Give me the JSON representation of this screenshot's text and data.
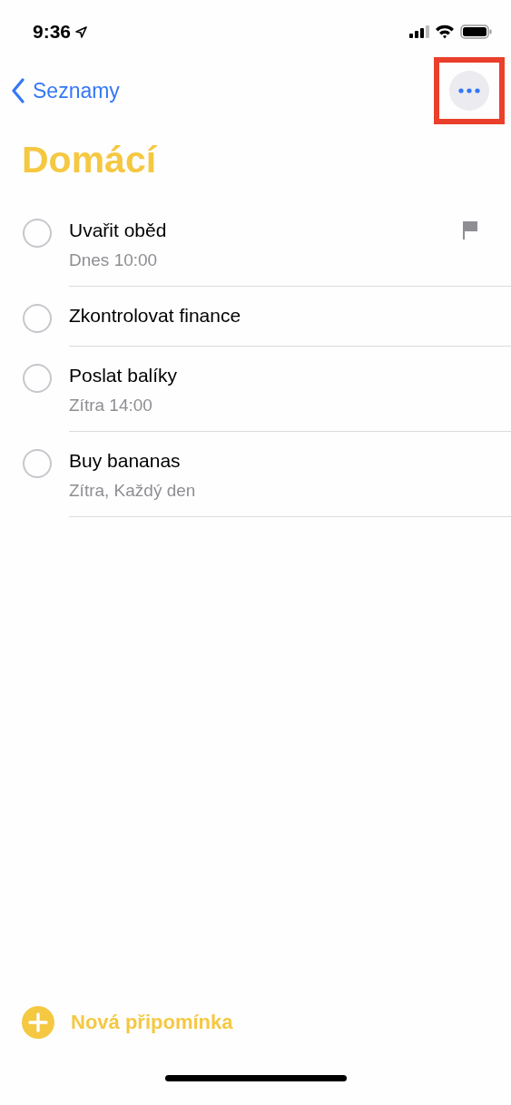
{
  "status_bar": {
    "time": "9:36"
  },
  "nav": {
    "back_label": "Seznamy"
  },
  "list": {
    "title": "Domácí"
  },
  "reminders": [
    {
      "title": "Uvařit oběd",
      "subtitle": "Dnes 10:00",
      "flagged": true,
      "completed": false
    },
    {
      "title": "Zkontrolovat finance",
      "flagged": false,
      "completed": false
    },
    {
      "title": "Poslat balíky",
      "subtitle": "Zítra 14:00",
      "flagged": false,
      "completed": false
    },
    {
      "title": "Buy bananas",
      "subtitle": "Zítra, Každý den",
      "flagged": false,
      "completed": false
    }
  ],
  "footer": {
    "new_label": "Nová připomínka"
  }
}
